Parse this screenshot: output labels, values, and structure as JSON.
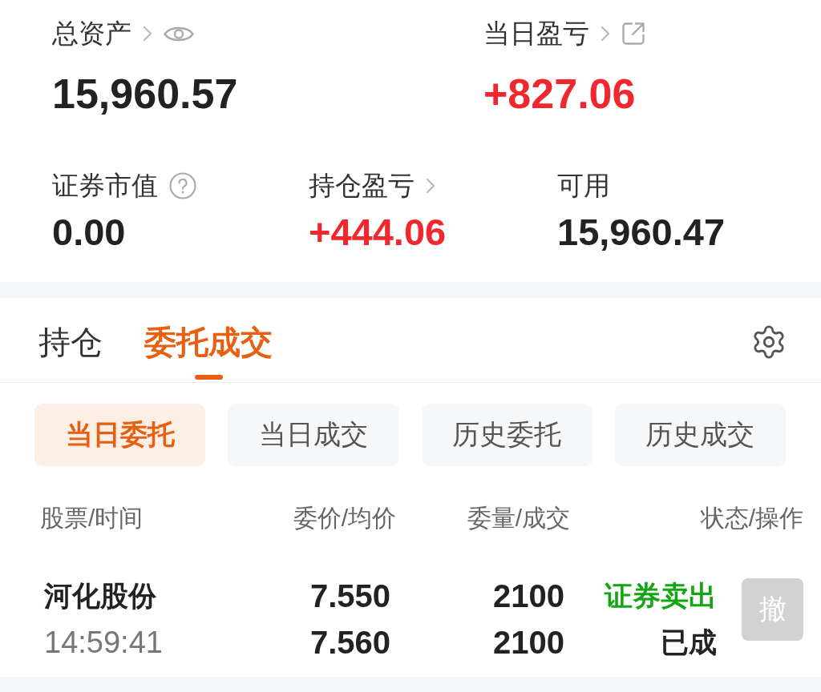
{
  "headline": [
    {
      "label": "总资产",
      "value": "15,960.57",
      "kind": "hideable",
      "color": "#222222"
    },
    {
      "label": "当日盈亏",
      "value": "+827.06",
      "kind": "share",
      "color": "#f0282d"
    }
  ],
  "metrics": [
    {
      "label": "证券市值",
      "value": "0.00",
      "kind": "help",
      "color": "#222222"
    },
    {
      "label": "持仓盈亏",
      "value": "+444.06",
      "kind": "link",
      "color": "#f0282d"
    },
    {
      "label": "可用",
      "value": "15,960.47",
      "kind": "plain",
      "color": "#222222"
    }
  ],
  "tabs": [
    {
      "label": "持仓",
      "selected": false
    },
    {
      "label": "委托成交",
      "selected": true
    }
  ],
  "filters": [
    {
      "label": "当日委托",
      "selected": true
    },
    {
      "label": "当日成交",
      "selected": false
    },
    {
      "label": "历史委托",
      "selected": false
    },
    {
      "label": "历史成交",
      "selected": false
    }
  ],
  "table": {
    "columns": [
      "股票/时间",
      "委价/均价",
      "委量/成交",
      "状态/操作"
    ],
    "rows": [
      {
        "name": "河化股份",
        "time": "14:59:41",
        "order_price": "7.550",
        "avg_price": "7.560",
        "order_qty": "2100",
        "filled_qty": "2100",
        "side": {
          "label": "证券卖出",
          "color": "#14a514"
        },
        "status": "已成",
        "cancel": {
          "label": "撤",
          "disabled": true
        }
      }
    ]
  }
}
